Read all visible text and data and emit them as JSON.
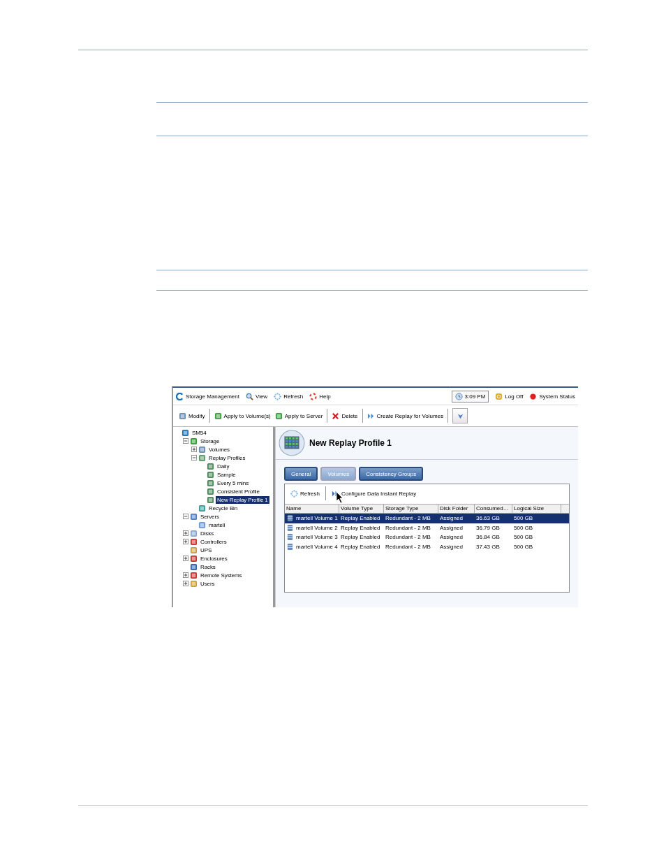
{
  "app": {
    "top_bar": {
      "items": [
        {
          "kind": "logo",
          "label": "Storage Management"
        },
        {
          "kind": "view",
          "label": "View"
        },
        {
          "kind": "refresh",
          "label": "Refresh"
        },
        {
          "kind": "help",
          "label": "Help"
        }
      ],
      "clock": "3:09 PM",
      "log_off": "Log Off",
      "system_status": "System Status"
    },
    "toolbar": [
      {
        "kind": "modify",
        "label": "Modify"
      },
      {
        "kind": "apply-volume",
        "label": "Apply to Volume(s)"
      },
      {
        "kind": "apply-server",
        "label": "Apply to Server"
      },
      {
        "kind": "delete",
        "label": "Delete"
      },
      {
        "kind": "replay",
        "label": "Create Replay for Volumes"
      },
      {
        "kind": "dropdown"
      }
    ],
    "tree": [
      {
        "label": "SM54",
        "kind": "system",
        "selected": false,
        "children": [
          {
            "label": "Storage",
            "kind": "storage",
            "selected": false,
            "expanded": true,
            "children": [
              {
                "label": "Volumes",
                "kind": "volumes",
                "selected": false,
                "expanded": false
              },
              {
                "label": "Replay Profiles",
                "kind": "profiles",
                "selected": false,
                "expanded": true,
                "children": [
                  {
                    "label": "Daily",
                    "kind": "profile",
                    "selected": false
                  },
                  {
                    "label": "Sample",
                    "kind": "profile",
                    "selected": false
                  },
                  {
                    "label": "Every 5 mins",
                    "kind": "profile",
                    "selected": false
                  },
                  {
                    "label": "Consistent Profile",
                    "kind": "profile",
                    "selected": false
                  },
                  {
                    "label": "New Replay Profile 1",
                    "kind": "profile",
                    "selected": true
                  }
                ]
              },
              {
                "label": "Recycle Bin",
                "kind": "bin",
                "selected": false
              }
            ]
          },
          {
            "label": "Servers",
            "kind": "servers",
            "selected": false,
            "expanded": true,
            "children": [
              {
                "label": "martell",
                "kind": "server",
                "selected": false
              }
            ]
          },
          {
            "label": "Disks",
            "kind": "disks",
            "selected": false,
            "expanded": false
          },
          {
            "label": "Controllers",
            "kind": "controllers",
            "selected": false,
            "expanded": false
          },
          {
            "label": "UPS",
            "kind": "ups",
            "selected": false
          },
          {
            "label": "Enclosures",
            "kind": "enclosures",
            "selected": false,
            "expanded": false
          },
          {
            "label": "Racks",
            "kind": "racks",
            "selected": false
          },
          {
            "label": "Remote Systems",
            "kind": "remote",
            "selected": false,
            "expanded": false
          },
          {
            "label": "Users",
            "kind": "users",
            "selected": false,
            "expanded": false
          }
        ]
      }
    ],
    "panel": {
      "title": "New Replay Profile 1",
      "tabs": [
        {
          "label": "General",
          "selected": false
        },
        {
          "label": "Volumes",
          "selected": true
        },
        {
          "label": "Consistency Groups",
          "selected": false
        }
      ],
      "actions": [
        {
          "kind": "refresh",
          "label": "Refresh"
        },
        {
          "kind": "configure",
          "label": "Configure Data Instant Replay"
        }
      ],
      "table": {
        "columns": [
          "Name",
          "Volume Type",
          "Storage Type",
          "Disk Folder",
          "Consumed…",
          "Logical Size"
        ],
        "rows": [
          {
            "selected": true,
            "cells": [
              "martell Volume 1",
              "Replay Enabled",
              "Redundant - 2 MB",
              "Assigned",
              "36.63 GB",
              "500 GB"
            ]
          },
          {
            "selected": false,
            "cells": [
              "martell Volume 2",
              "Replay Enabled",
              "Redundant - 2 MB",
              "Assigned",
              "36.79 GB",
              "500 GB"
            ]
          },
          {
            "selected": false,
            "cells": [
              "martell Volume 3",
              "Replay Enabled",
              "Redundant - 2 MB",
              "Assigned",
              "36.84 GB",
              "500 GB"
            ]
          },
          {
            "selected": false,
            "cells": [
              "martell Volume 4",
              "Replay Enabled",
              "Redundant - 2 MB",
              "Assigned",
              "37.43 GB",
              "500 GB"
            ]
          }
        ]
      }
    }
  }
}
